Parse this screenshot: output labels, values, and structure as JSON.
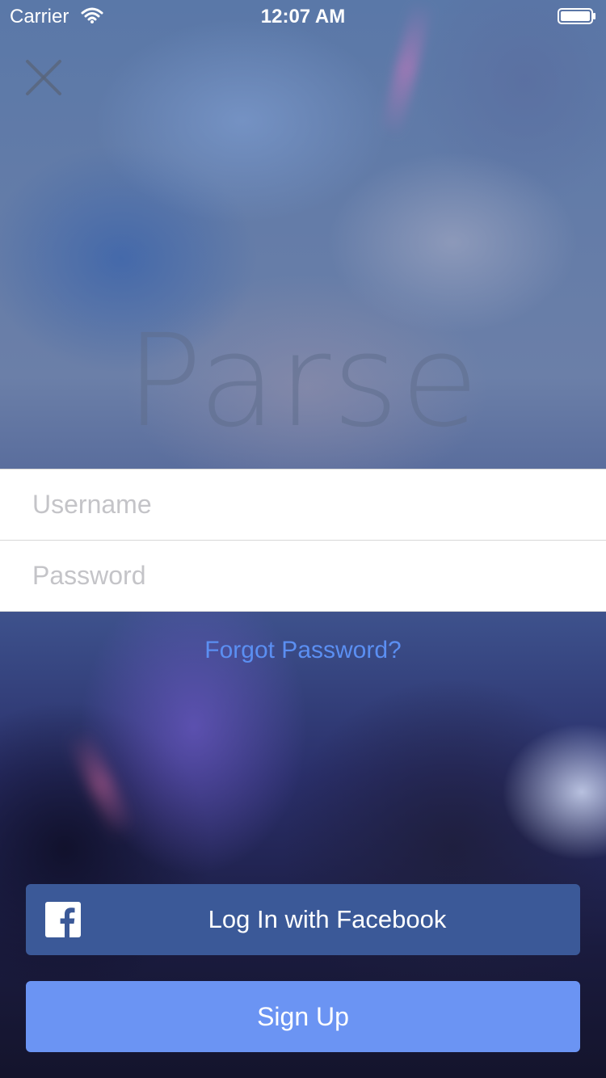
{
  "status_bar": {
    "carrier": "Carrier",
    "time": "12:07 AM"
  },
  "logo": {
    "text": "Parse"
  },
  "login_form": {
    "username_placeholder": "Username",
    "password_placeholder": "Password",
    "username_value": "",
    "password_value": ""
  },
  "links": {
    "forgot_password": "Forgot Password?"
  },
  "buttons": {
    "facebook_label": "Log In with Facebook",
    "signup_label": "Sign Up"
  },
  "icons": {
    "close": "close-icon",
    "wifi": "wifi-icon",
    "battery": "battery-icon",
    "facebook": "facebook-icon"
  },
  "colors": {
    "facebook_button": "#3b5998",
    "signup_button": "#6b94f3",
    "link": "#5b8ff2"
  }
}
